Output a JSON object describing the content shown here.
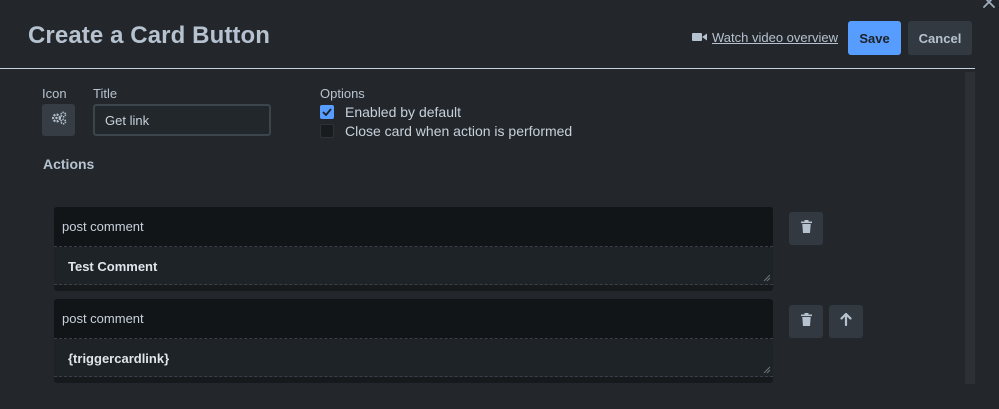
{
  "header": {
    "title": "Create a Card Button",
    "watch_label": "Watch video overview",
    "save_label": "Save",
    "cancel_label": "Cancel"
  },
  "form": {
    "icon_label": "Icon",
    "icon_name": "gears-icon",
    "title_label": "Title",
    "title_value": "Get link",
    "options_label": "Options",
    "options": [
      {
        "label": "Enabled by default",
        "checked": true
      },
      {
        "label": "Close card when action is performed",
        "checked": false
      }
    ]
  },
  "actions": {
    "heading": "Actions",
    "items": [
      {
        "type": "post comment",
        "value": "Test Comment"
      },
      {
        "type": "post comment",
        "value": "{triggercardlink}"
      }
    ]
  },
  "colors": {
    "background": "#23272b",
    "accent": "#579dff",
    "text": "#b6c2cf"
  }
}
